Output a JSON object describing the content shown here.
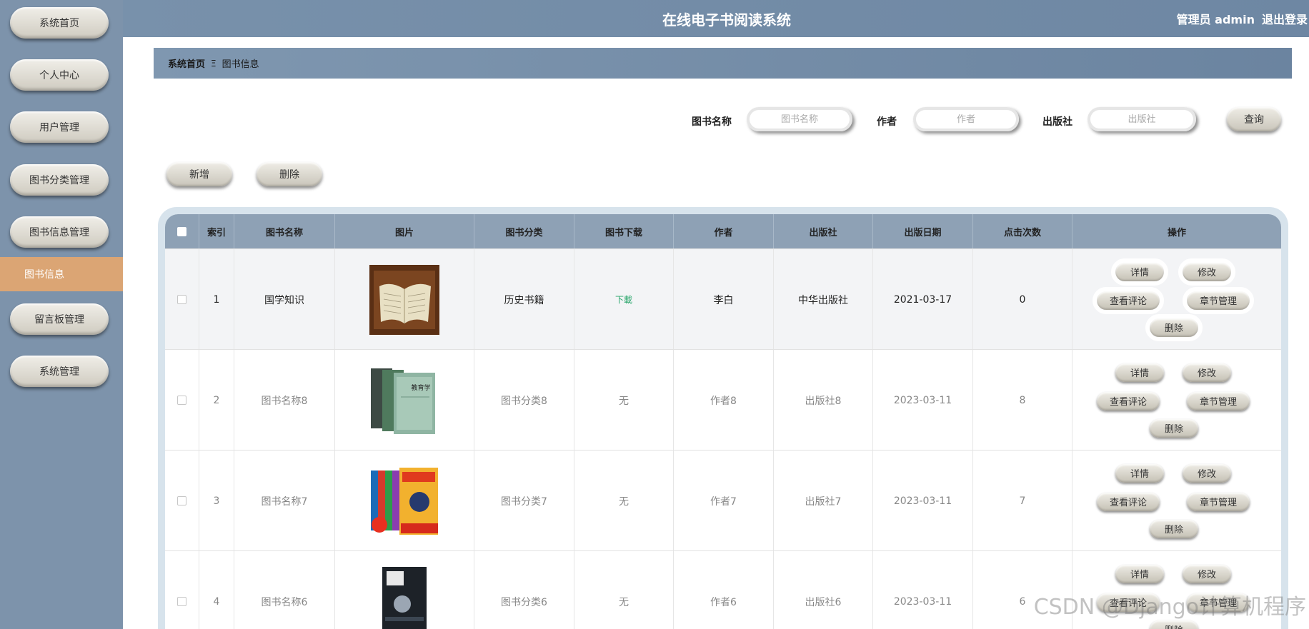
{
  "app": {
    "title": "在线电子书阅读系统",
    "user_label": "管理员 admin",
    "logout_label": "退出登录"
  },
  "sidebar": {
    "items": [
      {
        "label": "系统首页"
      },
      {
        "label": "个人中心"
      },
      {
        "label": "用户管理"
      },
      {
        "label": "图书分类管理"
      },
      {
        "label": "图书信息管理"
      },
      {
        "label": "留言板管理"
      },
      {
        "label": "系统管理"
      }
    ],
    "active_sub": "图书信息"
  },
  "breadcrumb": {
    "home": "系统首页",
    "separator": "Ξ",
    "current": "图书信息"
  },
  "search": {
    "name_label": "图书名称",
    "name_placeholder": "图书名称",
    "author_label": "作者",
    "author_placeholder": "作者",
    "publisher_label": "出版社",
    "publisher_placeholder": "出版社",
    "query_label": "查询"
  },
  "actions": {
    "add_label": "新增",
    "delete_label": "删除"
  },
  "table": {
    "headers": [
      "索引",
      "图书名称",
      "图片",
      "图书分类",
      "图书下载",
      "作者",
      "出版社",
      "出版日期",
      "点击次数",
      "操作"
    ],
    "rows": [
      {
        "index": "1",
        "name": "国学知识",
        "category": "历史书籍",
        "download": "下載",
        "author": "李白",
        "publisher": "中华出版社",
        "date": "2021-03-17",
        "clicks": "0"
      },
      {
        "index": "2",
        "name": "图书名称8",
        "category": "图书分类8",
        "download": "无",
        "author": "作者8",
        "publisher": "出版社8",
        "date": "2023-03-11",
        "clicks": "8"
      },
      {
        "index": "3",
        "name": "图书名称7",
        "category": "图书分类7",
        "download": "无",
        "author": "作者7",
        "publisher": "出版社7",
        "date": "2023-03-11",
        "clicks": "7"
      },
      {
        "index": "4",
        "name": "图书名称6",
        "category": "图书分类6",
        "download": "无",
        "author": "作者6",
        "publisher": "出版社6",
        "date": "2023-03-11",
        "clicks": "6"
      }
    ],
    "ops": {
      "detail": "详情",
      "edit": "修改",
      "comments": "查看评论",
      "chapters": "章节管理",
      "delete": "删除"
    }
  },
  "watermark": "CSDN @Django计算机程序",
  "colors": {
    "sidebar": "#7d93ab",
    "header": "#7891ab",
    "active_item": "#dba574",
    "download_link": "#2aa66b"
  }
}
